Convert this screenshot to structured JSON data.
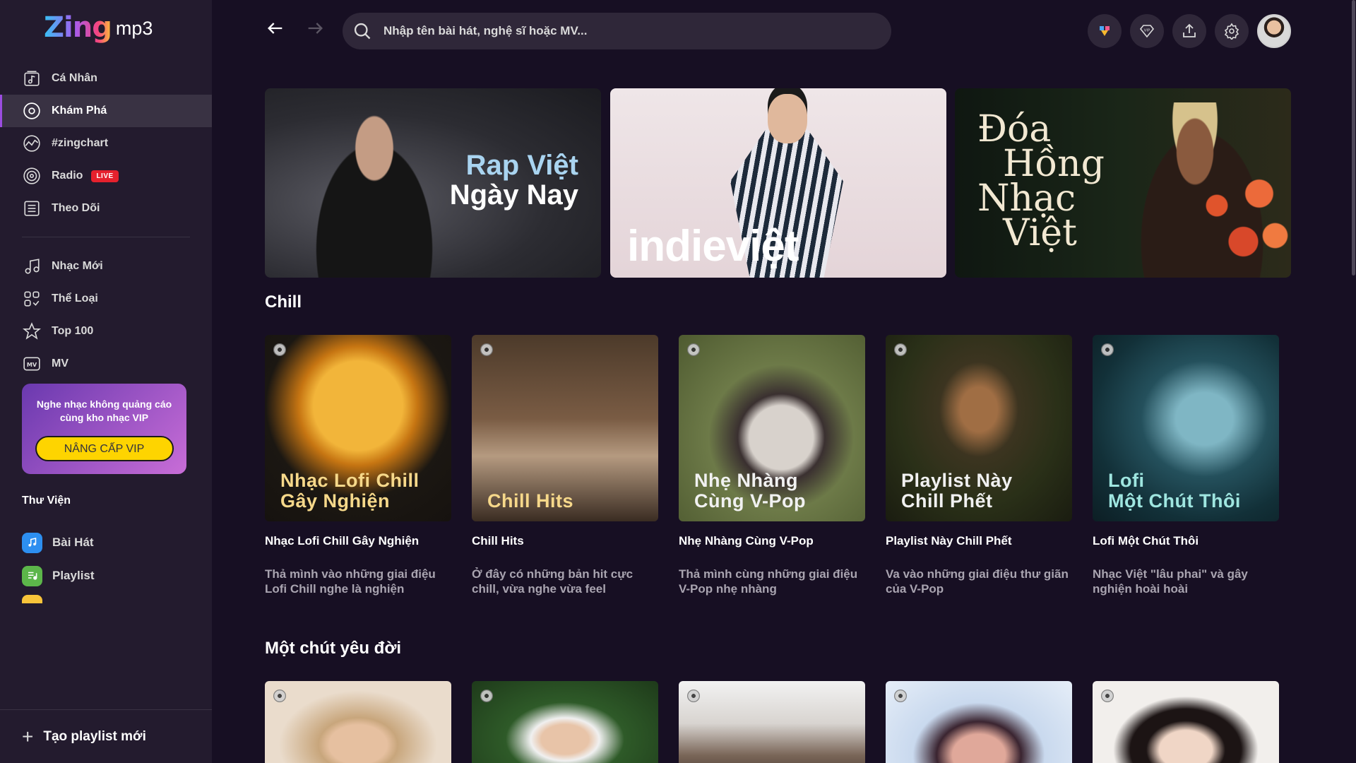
{
  "app": {
    "logo_main": "Zing",
    "logo_sub": "mp3"
  },
  "sidebar": {
    "items": [
      {
        "label": "Cá Nhân",
        "icon": "personal-music-icon"
      },
      {
        "label": "Khám Phá",
        "icon": "disc-icon",
        "active": true
      },
      {
        "label": "#zingchart",
        "icon": "chart-icon"
      },
      {
        "label": "Radio",
        "icon": "radio-icon",
        "badge": "LIVE"
      },
      {
        "label": "Theo Dõi",
        "icon": "news-icon"
      }
    ],
    "items2": [
      {
        "label": "Nhạc Mới",
        "icon": "music-note-icon"
      },
      {
        "label": "Thể Loại",
        "icon": "category-icon"
      },
      {
        "label": "Top 100",
        "icon": "star-icon"
      },
      {
        "label": "MV",
        "icon": "mv-icon"
      }
    ],
    "vip": {
      "text": "Nghe nhạc không quảng cáo cùng kho nhạc VIP",
      "button": "NÂNG CẤP VIP"
    },
    "library": {
      "title": "Thư Viện",
      "items": [
        {
          "label": "Bài Hát",
          "icon": "song-library-icon",
          "color": "#2d8ff0"
        },
        {
          "label": "Playlist",
          "icon": "playlist-library-icon",
          "color": "#5cb64a"
        }
      ]
    },
    "create_playlist": "Tạo playlist mới"
  },
  "header": {
    "search_placeholder": "Nhập tên bài hát, nghệ sĩ hoặc MV...",
    "buttons": [
      "theme-icon",
      "vip-icon",
      "upload-icon",
      "settings-icon"
    ]
  },
  "banners": [
    {
      "line1": "Rap Việt",
      "line2": "Ngày Nay"
    },
    {
      "title": "indieviệt"
    },
    {
      "lines": [
        "Đóa",
        "Hồng",
        "Nhạc",
        "Việt"
      ]
    }
  ],
  "sections": [
    {
      "title": "Chill",
      "cards": [
        {
          "cover": "Nhạc Lofi Chill\nGây Nghiện",
          "name": "Nhạc Lofi Chill Gây Nghiện",
          "desc": "Thả mình vào những giai điệu Lofi Chill nghe là nghiện"
        },
        {
          "cover": "Chill Hits",
          "name": "Chill Hits",
          "desc": "Ở đây có những bản hit cực chill, vừa nghe vừa feel"
        },
        {
          "cover": "Nhẹ Nhàng\nCùng V-Pop",
          "name": "Nhẹ Nhàng Cùng V-Pop",
          "desc": "Thả mình cùng những giai điệu V-Pop nhẹ nhàng"
        },
        {
          "cover": "Playlist Này\nChill Phết",
          "name": "Playlist Này Chill Phết",
          "desc": "Va vào những giai điệu thư giãn của V-Pop"
        },
        {
          "cover": "Lofi\nMột Chút Thôi",
          "name": "Lofi Một Chút Thôi",
          "desc": "Nhạc Việt \"lâu phai\" và gây nghiện hoài hoài"
        }
      ]
    },
    {
      "title": "Một chút yêu đời"
    }
  ]
}
